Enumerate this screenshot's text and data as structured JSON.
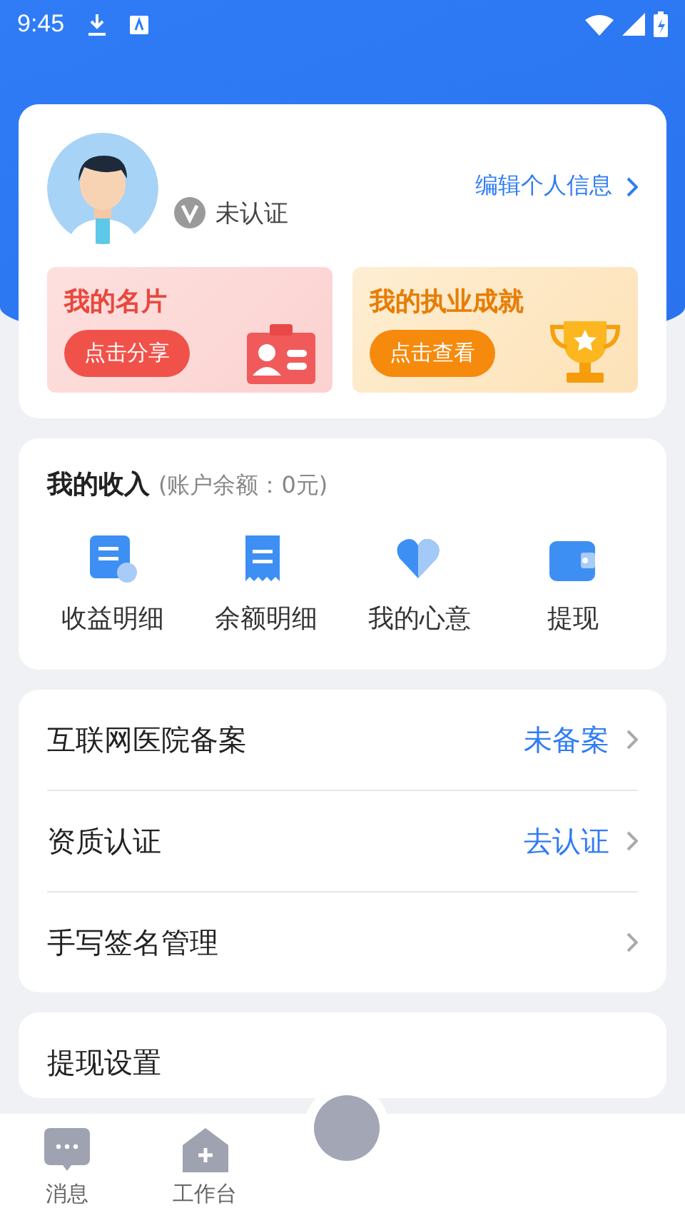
{
  "status_bar": {
    "time": "9:45"
  },
  "profile": {
    "status": "未认证",
    "edit_link": "编辑个人信息"
  },
  "promo_cards": [
    {
      "kind": "card",
      "title": "我的名片",
      "button": "点击分享"
    },
    {
      "kind": "trophy",
      "title": "我的执业成就",
      "button": "点击查看"
    }
  ],
  "income": {
    "title": "我的收入",
    "balance": "(账户余额：0元)",
    "actions": [
      {
        "kind": "bill",
        "label": "收益明细"
      },
      {
        "kind": "receipt",
        "label": "余额明细"
      },
      {
        "kind": "heart",
        "label": "我的心意"
      },
      {
        "kind": "wallet",
        "label": "提现"
      }
    ]
  },
  "menu": [
    {
      "label": "互联网医院备案",
      "value": "未备案"
    },
    {
      "label": "资质认证",
      "value": "去认证"
    },
    {
      "label": "手写签名管理"
    }
  ],
  "next_section": {
    "title": "提现设置"
  },
  "tab_bar": [
    {
      "kind": "message",
      "label": "消息"
    },
    {
      "kind": "workbench",
      "label": "工作台"
    }
  ]
}
